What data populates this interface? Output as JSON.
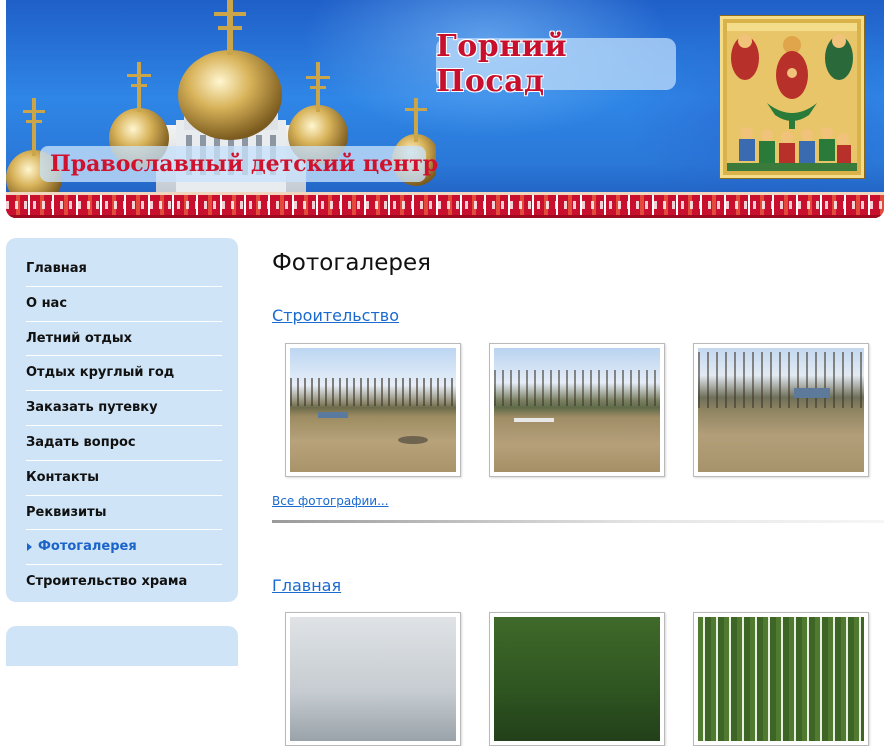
{
  "header": {
    "logo_text": "Горний Посад",
    "slogan": "Православный детский центр"
  },
  "sidebar": {
    "items": [
      {
        "label": "Главная",
        "active": false
      },
      {
        "label": "О нас",
        "active": false
      },
      {
        "label": "Летний отдых",
        "active": false
      },
      {
        "label": "Отдых круглый год",
        "active": false
      },
      {
        "label": "Заказать путевку",
        "active": false
      },
      {
        "label": "Задать вопрос",
        "active": false
      },
      {
        "label": "Контакты",
        "active": false
      },
      {
        "label": "Реквизиты",
        "active": false
      },
      {
        "label": "Фотогалерея",
        "active": true
      },
      {
        "label": "Строительство храма",
        "active": false
      }
    ]
  },
  "main": {
    "page_title": "Фотогалерея",
    "sections": [
      {
        "title": "Строительство",
        "more_link": "Все фотографии..."
      },
      {
        "title": "Главная"
      }
    ]
  },
  "colors": {
    "link": "#1a6ad0",
    "active_menu": "#1b64c9",
    "sidebar_bg": "#cfe4f6",
    "brand_red": "#c8102e"
  }
}
